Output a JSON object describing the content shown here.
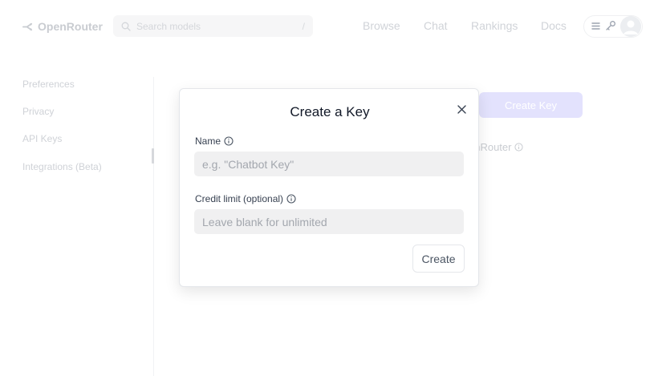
{
  "header": {
    "brand": "OpenRouter",
    "search": {
      "placeholder": "Search models",
      "shortcut": "/"
    },
    "nav": [
      "Browse",
      "Chat",
      "Rankings",
      "Docs"
    ],
    "icons": [
      "menu-icon",
      "key-icon",
      "avatar"
    ]
  },
  "sidebar": {
    "items": [
      {
        "label": "Preferences"
      },
      {
        "label": "Privacy"
      },
      {
        "label": "API Keys"
      },
      {
        "label": "Integrations (Beta)"
      }
    ]
  },
  "background": {
    "create_key_label": "Create Key",
    "provider_text": "enRouter"
  },
  "modal": {
    "title": "Create a Key",
    "name_label": "Name",
    "name_placeholder": "e.g. \"Chatbot Key\"",
    "name_value": "",
    "credit_label": "Credit limit (optional)",
    "credit_placeholder": "Leave blank for unlimited",
    "credit_value": "",
    "submit_label": "Create"
  },
  "colors": {
    "accent": "#e3e2fd",
    "modal_border": "#e4e6ea",
    "input_bg": "#f0f0f1"
  }
}
